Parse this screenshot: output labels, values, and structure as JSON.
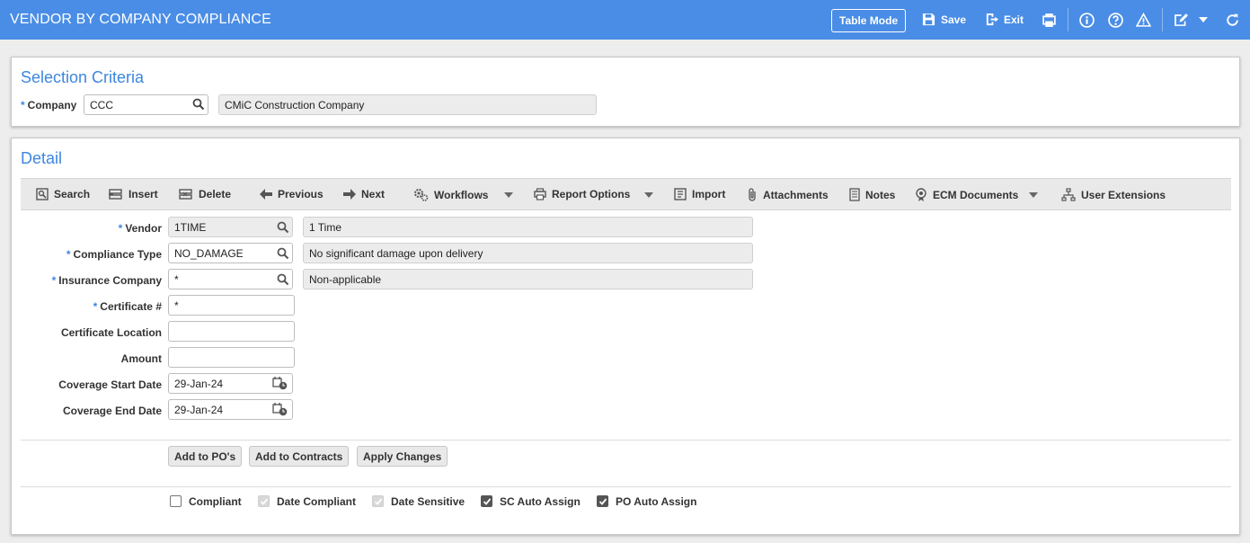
{
  "header": {
    "title": "VENDOR BY COMPANY COMPLIANCE",
    "table_mode_label": "Table Mode",
    "save_label": "Save",
    "exit_label": "Exit"
  },
  "selection": {
    "title": "Selection Criteria",
    "company_label": "Company",
    "company_value": "CCC",
    "company_name": "CMiC Construction Company"
  },
  "detail": {
    "title": "Detail",
    "toolbar": {
      "search": "Search",
      "insert": "Insert",
      "delete": "Delete",
      "previous": "Previous",
      "next": "Next",
      "workflows": "Workflows",
      "report_options": "Report Options",
      "import": "Import",
      "attachments": "Attachments",
      "notes": "Notes",
      "ecm_documents": "ECM Documents",
      "user_extensions": "User Extensions"
    },
    "fields": {
      "vendor_label": "Vendor",
      "vendor_value": "1TIME",
      "vendor_desc": "1 Time",
      "compliance_type_label": "Compliance Type",
      "compliance_type_value": "NO_DAMAGE",
      "compliance_type_desc": "No significant damage upon delivery",
      "insurance_company_label": "Insurance Company",
      "insurance_company_value": "*",
      "insurance_company_desc": "Non-applicable",
      "certificate_no_label": "Certificate #",
      "certificate_no_value": "*",
      "certificate_location_label": "Certificate Location",
      "certificate_location_value": "",
      "amount_label": "Amount",
      "amount_value": "",
      "coverage_start_label": "Coverage Start Date",
      "coverage_start_value": "29-Jan-24",
      "coverage_end_label": "Coverage End Date",
      "coverage_end_value": "29-Jan-24"
    },
    "buttons": {
      "add_to_pos": "Add to PO's",
      "add_to_contracts": "Add to Contracts",
      "apply_changes": "Apply Changes"
    },
    "checkboxes": {
      "compliant": {
        "label": "Compliant",
        "checked": false,
        "disabled": false
      },
      "date_compliant": {
        "label": "Date Compliant",
        "checked": true,
        "disabled": true
      },
      "date_sensitive": {
        "label": "Date Sensitive",
        "checked": true,
        "disabled": true
      },
      "sc_auto_assign": {
        "label": "SC Auto Assign",
        "checked": true,
        "disabled": false
      },
      "po_auto_assign": {
        "label": "PO Auto Assign",
        "checked": true,
        "disabled": false
      }
    }
  },
  "colors": {
    "header_bg": "#4a8de6",
    "title_blue": "#3c86e0"
  }
}
